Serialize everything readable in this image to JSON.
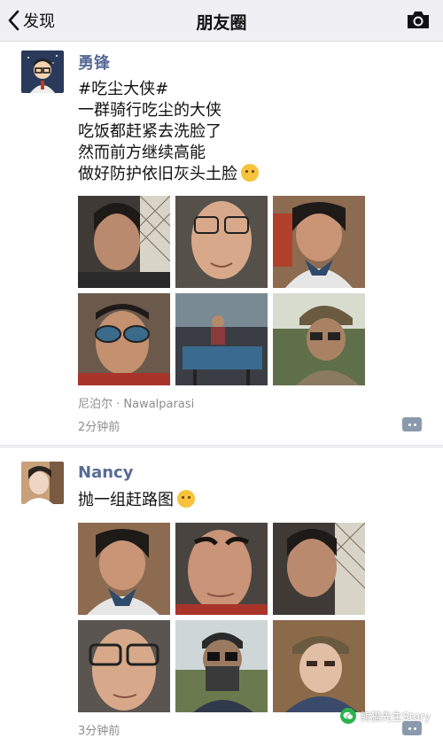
{
  "nav": {
    "back_label": "发现",
    "title": "朋友圈"
  },
  "posts": [
    {
      "username": "勇锋",
      "text_lines": [
        "#吃尘大侠#",
        "一群骑行吃尘的大侠",
        "吃饭都赶紧去洗脸了",
        "然而前方继续高能",
        "做好防护依旧灰头土脸"
      ],
      "location": "尼泊尔 · Nawalparasi",
      "time": "2分钟前"
    },
    {
      "username": "Nancy",
      "text_lines": [
        "抛一组赶路图"
      ],
      "time": "3分钟前"
    }
  ],
  "watermark": "熊猫先生Story",
  "colors": {
    "name": "#576b95",
    "navbar": "#efeff4",
    "meta": "#8c8c8c",
    "comment": "#8a9aac"
  },
  "icons": [
    "back-chevron-icon",
    "camera-icon",
    "comment-icon",
    "wechat-icon"
  ]
}
